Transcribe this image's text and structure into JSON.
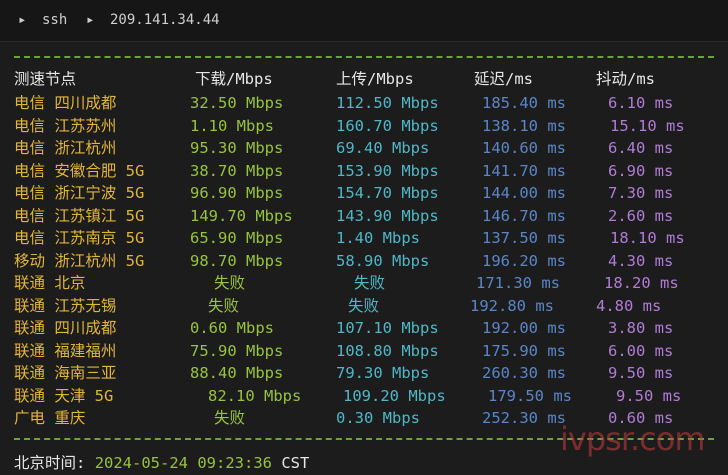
{
  "titlebar": {
    "arrow1": "▸",
    "session": "ssh",
    "arrow2": "▸",
    "host": "209.141.34.44"
  },
  "table": {
    "headers": [
      "测速节点",
      "下载/Mbps",
      "上传/Mbps",
      "延迟/ms",
      "抖动/ms"
    ],
    "rows": [
      {
        "name": "电信 四川成都",
        "dl": "32.50 Mbps",
        "ul": "112.50 Mbps",
        "lat": "185.40 ms",
        "jit": "6.10 ms"
      },
      {
        "name": "电信 江苏苏州",
        "dl": "1.10 Mbps",
        "ul": "160.70 Mbps",
        "lat": "138.10 ms",
        "jit": "15.10 ms"
      },
      {
        "name": "电信 浙江杭州",
        "dl": "95.30 Mbps",
        "ul": "69.40 Mbps",
        "lat": "140.60 ms",
        "jit": "6.40 ms"
      },
      {
        "name": "电信 安徽合肥 5G",
        "dl": "38.70 Mbps",
        "ul": "153.90 Mbps",
        "lat": "141.70 ms",
        "jit": "6.90 ms"
      },
      {
        "name": "电信 浙江宁波 5G",
        "dl": "96.90 Mbps",
        "ul": "154.70 Mbps",
        "lat": "144.00 ms",
        "jit": "7.30 ms"
      },
      {
        "name": "电信 江苏镇江 5G",
        "dl": "149.70 Mbps",
        "ul": "143.90 Mbps",
        "lat": "146.70 ms",
        "jit": "2.60 ms"
      },
      {
        "name": "电信 江苏南京 5G",
        "dl": "65.90 Mbps",
        "ul": "1.40 Mbps",
        "lat": "137.50 ms",
        "jit": "18.10 ms"
      },
      {
        "name": "移动 浙江杭州 5G",
        "dl": "98.70 Mbps",
        "ul": "58.90 Mbps",
        "lat": "196.20 ms",
        "jit": "4.30 ms"
      },
      {
        "name": "联通 北京",
        "dl": "失败",
        "ul": "失败",
        "lat": "171.30 ms",
        "jit": "18.20 ms"
      },
      {
        "name": "联通 江苏无锡",
        "dl": "失败",
        "ul": "失败",
        "lat": "192.80 ms",
        "jit": "4.80 ms"
      },
      {
        "name": "联通 四川成都",
        "dl": "0.60 Mbps",
        "ul": "107.10 Mbps",
        "lat": "192.00 ms",
        "jit": "3.80 ms"
      },
      {
        "name": "联通 福建福州",
        "dl": "75.90 Mbps",
        "ul": "108.80 Mbps",
        "lat": "175.90 ms",
        "jit": "6.00 ms"
      },
      {
        "name": "联通 海南三亚",
        "dl": "88.40 Mbps",
        "ul": "79.30 Mbps",
        "lat": "260.30 ms",
        "jit": "9.50 ms"
      },
      {
        "name": "联通 天津 5G",
        "dl": "82.10 Mbps",
        "ul": "109.20 Mbps",
        "lat": "179.50 ms",
        "jit": "9.50 ms"
      },
      {
        "name": "广电 重庆",
        "dl": "失败",
        "ul": "0.30 Mbps",
        "lat": "252.30 ms",
        "jit": "0.60 ms"
      }
    ]
  },
  "footer": {
    "label": "北京时间:",
    "datetime": "2024-05-24 09:23:36",
    "tz": "CST"
  },
  "watermark": "ivpsr.com",
  "colors": {
    "name": "#e2b534",
    "download": "#98c33c",
    "upload": "#4fb7c8",
    "latency": "#5a86c8",
    "jitter": "#b07cd6",
    "divider": "#6aa43a"
  }
}
